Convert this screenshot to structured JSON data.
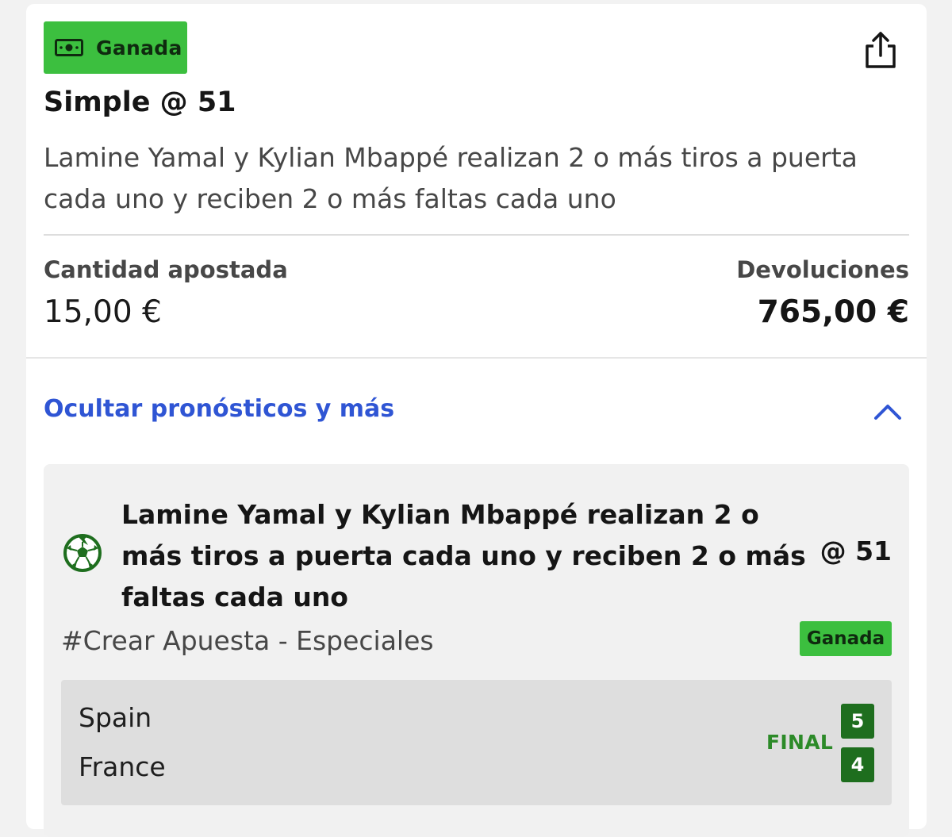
{
  "bet": {
    "status": "Ganada",
    "title": "Simple @ 51",
    "description": "Lamine Yamal y Kylian Mbappé realizan 2 o más tiros a puerta cada uno y reciben 2 o más faltas cada uno",
    "stake_label": "Cantidad apostada",
    "stake_value": "15,00 €",
    "returns_label": "Devoluciones",
    "returns_value": "765,00 €"
  },
  "toggle": {
    "label": "Ocultar pronósticos y más"
  },
  "selection": {
    "title": "Lamine Yamal y Kylian Mbappé realizan 2 o más tiros a puerta cada uno y reciben 2 o más faltas cada uno",
    "odds": "@ 51",
    "market": "#Crear Apuesta - Especiales",
    "result": "Ganada",
    "match": {
      "home_team": "Spain",
      "away_team": "France",
      "status": "FINAL",
      "home_score": "5",
      "away_score": "4"
    }
  },
  "colors": {
    "win_green": "#3cbf3f",
    "score_green": "#1e6e1e",
    "link_blue": "#2f55d4"
  },
  "icons": [
    "money-icon",
    "share-icon",
    "chevron-up-icon",
    "soccer-icon"
  ]
}
